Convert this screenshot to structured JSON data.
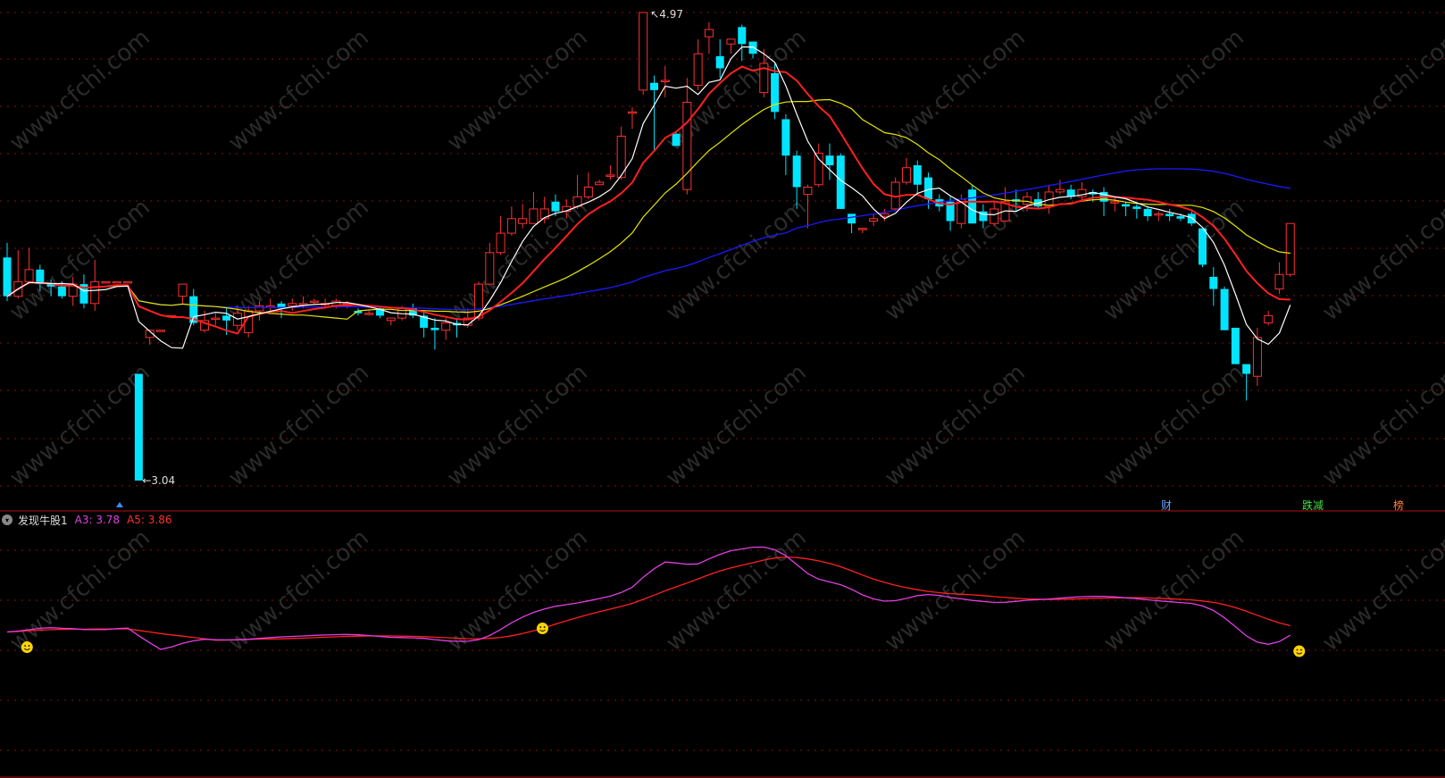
{
  "main_chart": {
    "high_label": "4.97",
    "low_label": "3.04",
    "markers": {
      "cai": "财",
      "dieting": "跌减",
      "bang": "榜"
    },
    "colors": {
      "up": "#ff3030",
      "down": "#00e5ff",
      "ma5": "#ffffff",
      "ma10": "#ff2020",
      "ma20": "#e6e600",
      "ma60": "#1a1aff"
    }
  },
  "indicator": {
    "name": "发现牛股1",
    "a3_text": "A3: 3.78",
    "a5_text": "A5: 3.86",
    "colors": {
      "a3": "#e040e0",
      "a5": "#ff2020"
    }
  },
  "watermark": "www.cfchi.com",
  "chart_data": {
    "type": "candlestick",
    "candles": [
      [
        3.96,
        3.8,
        4.02,
        3.78
      ],
      [
        3.8,
        3.86,
        3.99,
        3.79
      ],
      [
        3.86,
        3.91,
        4.0,
        3.85
      ],
      [
        3.91,
        3.85,
        3.93,
        3.82
      ],
      [
        3.85,
        3.84,
        3.87,
        3.8
      ],
      [
        3.84,
        3.8,
        3.86,
        3.79
      ],
      [
        3.8,
        3.85,
        3.88,
        3.76
      ],
      [
        3.85,
        3.77,
        3.89,
        3.75
      ],
      [
        3.77,
        3.86,
        3.95,
        3.74
      ],
      [
        3.86,
        3.86,
        3.86,
        3.86
      ],
      [
        3.86,
        3.86,
        3.86,
        3.86
      ],
      [
        3.86,
        3.86,
        3.86,
        3.86
      ],
      [
        3.48,
        3.04,
        3.48,
        3.04
      ],
      [
        3.63,
        3.66,
        3.66,
        3.6
      ],
      [
        3.66,
        3.66,
        3.66,
        3.66
      ],
      [
        3.72,
        3.72,
        3.72,
        3.72
      ],
      [
        3.8,
        3.85,
        3.85,
        3.77
      ],
      [
        3.8,
        3.69,
        3.83,
        3.68
      ],
      [
        3.66,
        3.7,
        3.74,
        3.65
      ],
      [
        3.71,
        3.71,
        3.73,
        3.68
      ],
      [
        3.72,
        3.7,
        3.75,
        3.64
      ],
      [
        3.68,
        3.73,
        3.76,
        3.66
      ],
      [
        3.65,
        3.74,
        3.76,
        3.63
      ],
      [
        3.74,
        3.76,
        3.78,
        3.7
      ],
      [
        3.76,
        3.76,
        3.79,
        3.74
      ],
      [
        3.77,
        3.75,
        3.78,
        3.71
      ],
      [
        3.76,
        3.77,
        3.79,
        3.74
      ],
      [
        3.77,
        3.77,
        3.8,
        3.75
      ],
      [
        3.78,
        3.78,
        3.79,
        3.77
      ],
      [
        3.77,
        3.77,
        3.79,
        3.75
      ],
      [
        3.76,
        3.78,
        3.79,
        3.75
      ],
      [
        3.76,
        3.77,
        3.78,
        3.75
      ],
      [
        3.74,
        3.73,
        3.75,
        3.72
      ],
      [
        3.73,
        3.73,
        3.74,
        3.72
      ],
      [
        3.75,
        3.72,
        3.76,
        3.71
      ],
      [
        3.7,
        3.71,
        3.71,
        3.68
      ],
      [
        3.71,
        3.75,
        3.76,
        3.7
      ],
      [
        3.75,
        3.72,
        3.77,
        3.71
      ],
      [
        3.72,
        3.67,
        3.74,
        3.63
      ],
      [
        3.67,
        3.66,
        3.71,
        3.58
      ],
      [
        3.66,
        3.69,
        3.71,
        3.62
      ],
      [
        3.69,
        3.68,
        3.71,
        3.63
      ],
      [
        3.68,
        3.71,
        3.75,
        3.67
      ],
      [
        3.71,
        3.85,
        3.86,
        3.7
      ],
      [
        3.85,
        3.98,
        4.02,
        3.85
      ],
      [
        3.98,
        4.06,
        4.13,
        3.97
      ],
      [
        4.06,
        4.12,
        4.17,
        4.05
      ],
      [
        4.1,
        4.12,
        4.18,
        4.08
      ],
      [
        4.1,
        4.16,
        4.23,
        4.1
      ],
      [
        4.12,
        4.16,
        4.21,
        4.1
      ],
      [
        4.19,
        4.15,
        4.22,
        4.13
      ],
      [
        4.15,
        4.17,
        4.2,
        4.12
      ],
      [
        4.17,
        4.21,
        4.3,
        4.16
      ],
      [
        4.21,
        4.25,
        4.31,
        4.2
      ],
      [
        4.26,
        4.27,
        4.28,
        4.26
      ],
      [
        4.3,
        4.3,
        4.34,
        4.28
      ],
      [
        4.29,
        4.46,
        4.5,
        4.28
      ],
      [
        4.56,
        4.56,
        4.58,
        4.49
      ],
      [
        4.65,
        4.97,
        4.97,
        4.63
      ],
      [
        4.68,
        4.65,
        4.71,
        4.4
      ],
      [
        4.69,
        4.69,
        4.75,
        4.62
      ],
      [
        4.47,
        4.42,
        4.48,
        4.42
      ],
      [
        4.24,
        4.6,
        4.7,
        4.22
      ],
      [
        4.67,
        4.8,
        4.86,
        4.65
      ],
      [
        4.87,
        4.9,
        4.93,
        4.8
      ],
      [
        4.79,
        4.74,
        4.86,
        4.7
      ],
      [
        4.84,
        4.86,
        4.86,
        4.8
      ],
      [
        4.91,
        4.84,
        4.92,
        4.77
      ],
      [
        4.85,
        4.8,
        4.85,
        4.78
      ],
      [
        4.64,
        4.76,
        4.82,
        4.62
      ],
      [
        4.72,
        4.56,
        4.76,
        4.53
      ],
      [
        4.53,
        4.38,
        4.55,
        4.3
      ],
      [
        4.38,
        4.25,
        4.4,
        4.16
      ],
      [
        4.22,
        4.25,
        4.26,
        4.08
      ],
      [
        4.26,
        4.39,
        4.43,
        4.25
      ],
      [
        4.38,
        4.34,
        4.43,
        4.28
      ],
      [
        4.38,
        4.16,
        4.39,
        4.16
      ],
      [
        4.14,
        4.1,
        4.14,
        4.06
      ],
      [
        4.08,
        4.08,
        4.08,
        4.06
      ],
      [
        4.11,
        4.12,
        4.14,
        4.09
      ],
      [
        4.13,
        4.14,
        4.16,
        4.11
      ],
      [
        4.16,
        4.27,
        4.29,
        4.15
      ],
      [
        4.27,
        4.33,
        4.37,
        4.26
      ],
      [
        4.34,
        4.26,
        4.36,
        4.22
      ],
      [
        4.29,
        4.2,
        4.31,
        4.16
      ],
      [
        4.2,
        4.17,
        4.22,
        4.15
      ],
      [
        4.19,
        4.11,
        4.21,
        4.07
      ],
      [
        4.1,
        4.2,
        4.22,
        4.08
      ],
      [
        4.24,
        4.1,
        4.26,
        4.1
      ],
      [
        4.15,
        4.11,
        4.18,
        4.08
      ],
      [
        4.1,
        4.16,
        4.19,
        4.09
      ],
      [
        4.11,
        4.19,
        4.25,
        4.11
      ],
      [
        4.2,
        4.19,
        4.24,
        4.15
      ],
      [
        4.18,
        4.21,
        4.23,
        4.15
      ],
      [
        4.2,
        4.17,
        4.23,
        4.16
      ],
      [
        4.17,
        4.23,
        4.26,
        4.14
      ],
      [
        4.23,
        4.24,
        4.28,
        4.22
      ],
      [
        4.24,
        4.21,
        4.26,
        4.2
      ],
      [
        4.21,
        4.24,
        4.27,
        4.19
      ],
      [
        4.23,
        4.22,
        4.24,
        4.19
      ],
      [
        4.23,
        4.19,
        4.25,
        4.13
      ],
      [
        4.19,
        4.19,
        4.21,
        4.15
      ],
      [
        4.18,
        4.17,
        4.19,
        4.13
      ],
      [
        4.17,
        4.16,
        4.18,
        4.12
      ],
      [
        4.16,
        4.13,
        4.17,
        4.11
      ],
      [
        4.14,
        4.14,
        4.15,
        4.11
      ],
      [
        4.14,
        4.13,
        4.16,
        4.11
      ],
      [
        4.13,
        4.12,
        4.14,
        4.11
      ],
      [
        4.14,
        4.1,
        4.15,
        4.09
      ],
      [
        4.08,
        3.93,
        4.08,
        3.92
      ],
      [
        3.88,
        3.83,
        3.92,
        3.76
      ],
      [
        3.83,
        3.66,
        3.84,
        3.66
      ],
      [
        3.67,
        3.52,
        3.67,
        3.52
      ],
      [
        3.52,
        3.48,
        3.52,
        3.37
      ],
      [
        3.47,
        3.63,
        3.67,
        3.43
      ],
      [
        3.69,
        3.72,
        3.74,
        3.68
      ],
      [
        3.83,
        3.89,
        3.94,
        3.81
      ],
      [
        3.89,
        4.1,
        4.1,
        3.88
      ]
    ]
  }
}
